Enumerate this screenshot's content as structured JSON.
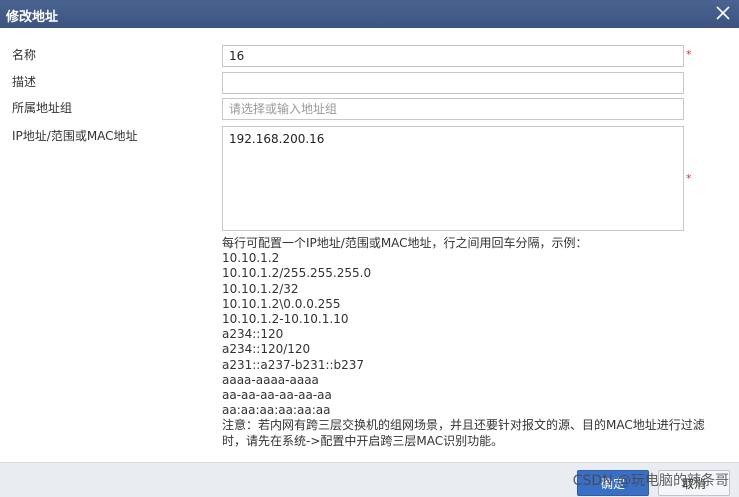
{
  "dialog": {
    "title": "修改地址",
    "close_icon": "close-icon"
  },
  "form": {
    "name": {
      "label": "名称",
      "value": "16",
      "required": "*"
    },
    "description": {
      "label": "描述",
      "value": ""
    },
    "address_group": {
      "label": "所属地址组",
      "placeholder": "请选择或输入地址组"
    },
    "ip_mac": {
      "label": "IP地址/范围或MAC地址",
      "value": "192.168.200.16",
      "required": "*"
    }
  },
  "help": {
    "intro": "每行可配置一个IP地址/范围或MAC地址，行之间用回车分隔，示例：",
    "examples": [
      "10.10.1.2",
      "10.10.1.2/255.255.255.0",
      "10.10.1.2/32",
      "10.10.1.2\\0.0.0.255",
      "10.10.1.2-10.10.1.10",
      "a234::120",
      "a234::120/120",
      "a231::a237-b231::b237",
      "aaaa-aaaa-aaaa",
      "aa-aa-aa-aa-aa-aa",
      "aa:aa:aa:aa:aa:aa"
    ],
    "note": "注意：若内网有跨三层交换机的组网场景，并且还要针对报文的源、目的MAC地址进行过滤时，请先在系统->配置中开启跨三层MAC识别功能。"
  },
  "footer": {
    "ok_label": "确定",
    "cancel_label": "取消"
  },
  "watermark": "CSDN @玩电脑的辣条哥",
  "colors": {
    "titlebar": "#3f5784",
    "primary_button": "#3a6fc6",
    "required": "#e03030"
  }
}
